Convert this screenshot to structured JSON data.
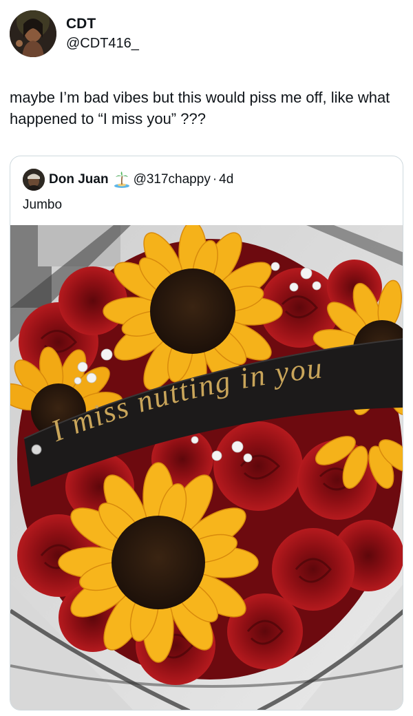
{
  "post": {
    "author": {
      "display_name": "CDT",
      "handle": "@CDT416_"
    },
    "text": "maybe I’m bad vibes but this would piss me off, like what happened to “I miss you” ???"
  },
  "quoted_post": {
    "author": {
      "display_name": "Don Juan",
      "emoji_icon": "palm-island-icon",
      "handle": "@317chappy",
      "separator": "·",
      "time": "4d"
    },
    "text": "Jumbo",
    "image": {
      "ribbon_text": "I miss nutting in you",
      "colors": {
        "rose": "#8e0f14",
        "sunflower": "#f5b21a",
        "ribbon": "#1c1a1a",
        "ribbon_text": "#c9a55a"
      }
    }
  }
}
